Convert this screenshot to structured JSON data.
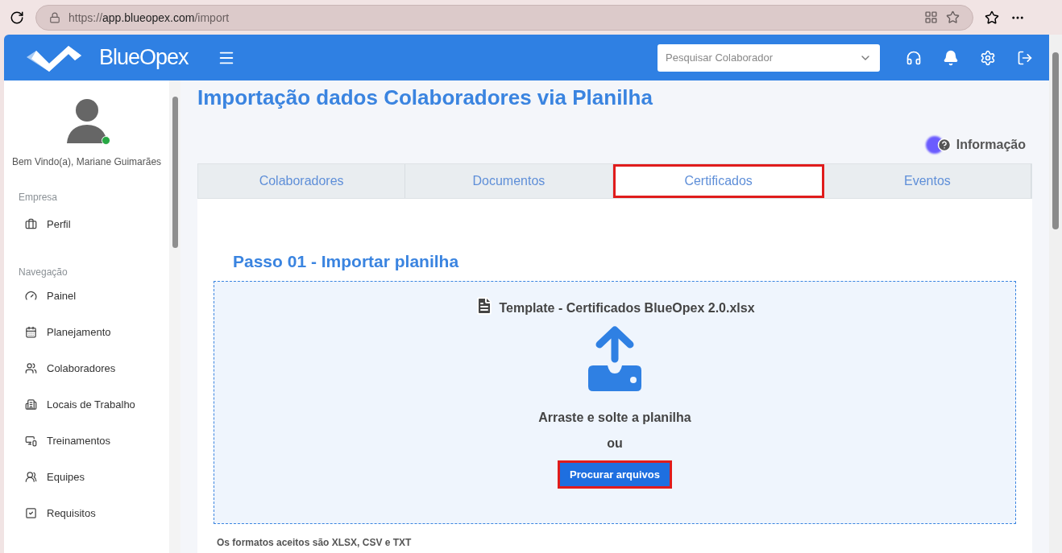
{
  "browser": {
    "url": {
      "scheme": "https://",
      "host": "app.blueopex.com",
      "path": "/import"
    }
  },
  "header": {
    "brand": "BlueOpex",
    "search": {
      "placeholder": "Pesquisar Colaborador"
    }
  },
  "sidebar": {
    "greeting": "Bem Vindo(a), Mariane Guimarães",
    "online": true,
    "sections": [
      {
        "title": "Empresa",
        "items": [
          {
            "label": "Perfil"
          }
        ]
      },
      {
        "title": "Navegação",
        "items": [
          {
            "label": "Painel"
          },
          {
            "label": "Planejamento"
          },
          {
            "label": "Colaboradores"
          },
          {
            "label": "Locais de Trabalho"
          },
          {
            "label": "Treinamentos"
          },
          {
            "label": "Equipes"
          },
          {
            "label": "Requisitos"
          }
        ]
      }
    ]
  },
  "page": {
    "title": "Importação dados Colaboradores via Planilha",
    "info": "Informação",
    "tabs": [
      {
        "label": "Colaboradores",
        "selected": false,
        "highlighted": false
      },
      {
        "label": "Documentos",
        "selected": false,
        "highlighted": false
      },
      {
        "label": "Certificados",
        "selected": true,
        "highlighted": true
      },
      {
        "label": "Eventos",
        "selected": false,
        "highlighted": false
      }
    ],
    "step_title": "Passo 01 - Importar planilha",
    "dropzone": {
      "template": "Template - Certificados BlueOpex 2.0.xlsx",
      "drag_text": "Arraste e solte a planilha",
      "or": "ou",
      "button": {
        "label": "Procurar arquivos",
        "highlighted": true
      }
    },
    "formats_note": "Os formatos aceitos são XLSX, CSV e TXT"
  }
}
